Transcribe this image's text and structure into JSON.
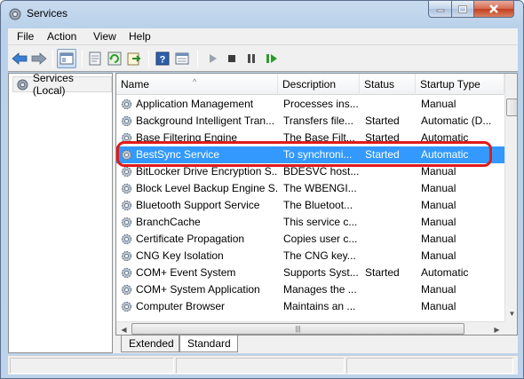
{
  "window": {
    "title": "Services"
  },
  "menu": {
    "file": "File",
    "action": "Action",
    "view": "View",
    "help": "Help"
  },
  "tree": {
    "root": "Services (Local)"
  },
  "columns": {
    "name": "Name",
    "description": "Description",
    "status": "Status",
    "startup": "Startup Type"
  },
  "rows": [
    {
      "name": "Application Management",
      "description": "Processes ins...",
      "status": "",
      "startup": "Manual"
    },
    {
      "name": "Background Intelligent Tran...",
      "description": "Transfers file...",
      "status": "Started",
      "startup": "Automatic (D..."
    },
    {
      "name": "Base Filtering Engine",
      "description": "The Base Filt...",
      "status": "Started",
      "startup": "Automatic"
    },
    {
      "name": "BestSync Service",
      "description": "To synchroni...",
      "status": "Started",
      "startup": "Automatic",
      "selected": true
    },
    {
      "name": "BitLocker Drive Encryption S...",
      "description": "BDESVC host...",
      "status": "",
      "startup": "Manual"
    },
    {
      "name": "Block Level Backup Engine S...",
      "description": "The WBENGI...",
      "status": "",
      "startup": "Manual"
    },
    {
      "name": "Bluetooth Support Service",
      "description": "The Bluetoot...",
      "status": "",
      "startup": "Manual"
    },
    {
      "name": "BranchCache",
      "description": "This service c...",
      "status": "",
      "startup": "Manual"
    },
    {
      "name": "Certificate Propagation",
      "description": "Copies user c...",
      "status": "",
      "startup": "Manual"
    },
    {
      "name": "CNG Key Isolation",
      "description": "The CNG key...",
      "status": "",
      "startup": "Manual"
    },
    {
      "name": "COM+ Event System",
      "description": "Supports Syst...",
      "status": "Started",
      "startup": "Automatic"
    },
    {
      "name": "COM+ System Application",
      "description": "Manages the ...",
      "status": "",
      "startup": "Manual"
    },
    {
      "name": "Computer Browser",
      "description": "Maintains an ...",
      "status": "",
      "startup": "Manual"
    }
  ],
  "tabs": {
    "extended": "Extended",
    "standard": "Standard"
  },
  "colors": {
    "selection": "#3399ff",
    "highlight": "#e21a1a"
  },
  "icons": [
    "services-app-icon",
    "back-arrow-icon",
    "forward-arrow-icon",
    "console-tree-icon",
    "properties-icon",
    "refresh-icon",
    "export-list-icon",
    "help-icon",
    "view-icon",
    "start-icon",
    "stop-icon",
    "pause-icon",
    "restart-icon",
    "gear-icon"
  ]
}
